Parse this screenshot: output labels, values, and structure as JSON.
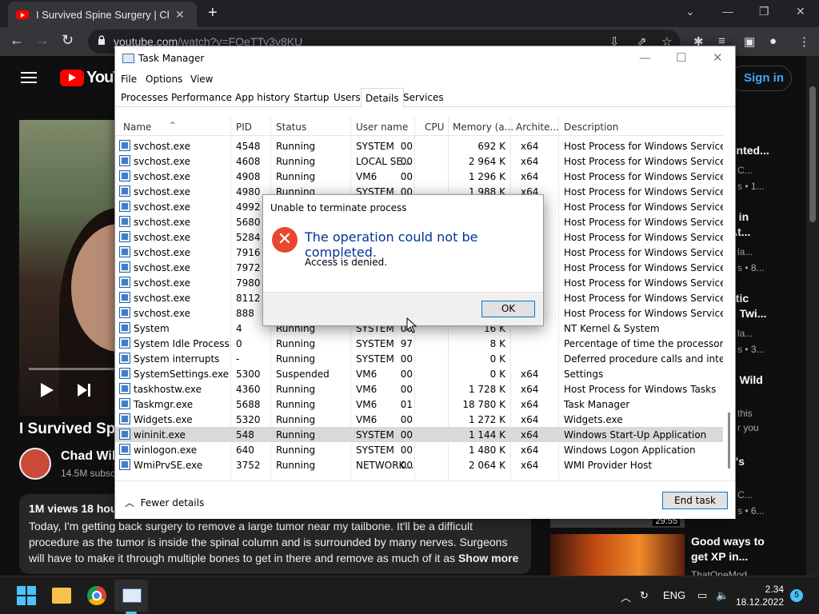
{
  "browser": {
    "tab_title": "I Survived Spine Surgery | Chad W",
    "url_host": "youtube.com",
    "url_path": "/watch?v=FOeTTy3v8KU"
  },
  "youtube": {
    "logo_text": "YouTu",
    "signin": "Sign in",
    "video_title": "I Survived Spi",
    "channel_name": "Chad Wil",
    "channel_subs": "14.5M subsc",
    "desc_stats": "1M views  18 hou",
    "desc_text": "Today, I'm getting back surgery to remove a large tumor near my tailbone. It'll be a difficult procedure as the tumor is inside the spinal column and is surrounded by many nerves. Surgeons will have to make it through multiple bones to get in there and remove as much of it as",
    "show_more": "Show more",
    "recs": [
      {
        "line1": "e",
        "line2": "unted...",
        "meta1": "C...",
        "meta2": "s • 1..."
      },
      {
        "line1": "e in",
        "line2": "At...",
        "meta1": "la...",
        "meta2": "s • 8..."
      },
      {
        "line1": "stic",
        "line2": "o Twi...",
        "meta1": "la...",
        "meta2": "s • 3..."
      },
      {
        "line1": "d Wild",
        "line2": "",
        "meta1": "this",
        "meta2": "r you"
      },
      {
        "line1": "e's",
        "line2": "",
        "meta1": "C...",
        "meta2": "s • 6..."
      },
      {
        "line1": "Good ways to",
        "line2": "get XP in...",
        "meta1": "ThatOneMod",
        "meta2": ""
      }
    ],
    "thumb_time": "29:55"
  },
  "taskmgr": {
    "title": "Task Manager",
    "menu": [
      "File",
      "Options",
      "View"
    ],
    "tabs": [
      "Processes",
      "Performance",
      "App history",
      "Startup",
      "Users",
      "Details",
      "Services"
    ],
    "columns": [
      "Name",
      "PID",
      "Status",
      "User name",
      "CPU",
      "Memory (a...",
      "Archite...",
      "Description"
    ],
    "rows": [
      [
        "svchost.exe",
        "4548",
        "Running",
        "SYSTEM",
        "00",
        "692 K",
        "x64",
        "Host Process for Windows Services"
      ],
      [
        "svchost.exe",
        "4608",
        "Running",
        "LOCAL SE...",
        "00",
        "2 964 K",
        "x64",
        "Host Process for Windows Services"
      ],
      [
        "svchost.exe",
        "4908",
        "Running",
        "VM6",
        "00",
        "1 296 K",
        "x64",
        "Host Process for Windows Services"
      ],
      [
        "svchost.exe",
        "4980",
        "Running",
        "SYSTEM",
        "00",
        "1 988 K",
        "x64",
        "Host Process for Windows Services"
      ],
      [
        "svchost.exe",
        "4992",
        "",
        "",
        "",
        "",
        "",
        "Host Process for Windows Services"
      ],
      [
        "svchost.exe",
        "5680",
        "",
        "",
        "",
        "",
        "",
        "Host Process for Windows Services"
      ],
      [
        "svchost.exe",
        "5284",
        "",
        "",
        "",
        "",
        "",
        "Host Process for Windows Services"
      ],
      [
        "svchost.exe",
        "7916",
        "",
        "",
        "",
        "",
        "",
        "Host Process for Windows Services"
      ],
      [
        "svchost.exe",
        "7972",
        "",
        "",
        "",
        "",
        "",
        "Host Process for Windows Services"
      ],
      [
        "svchost.exe",
        "7980",
        "",
        "",
        "",
        "",
        "",
        "Host Process for Windows Services"
      ],
      [
        "svchost.exe",
        "8112",
        "",
        "",
        "",
        "",
        "",
        "Host Process for Windows Services"
      ],
      [
        "svchost.exe",
        "888",
        "",
        "",
        "",
        "",
        "",
        "Host Process for Windows Services"
      ],
      [
        "System",
        "4",
        "Running",
        "SYSTEM",
        "00",
        "16 K",
        "",
        "NT Kernel & System"
      ],
      [
        "System Idle Process",
        "0",
        "Running",
        "SYSTEM",
        "97",
        "8 K",
        "",
        "Percentage of time the processor i..."
      ],
      [
        "System interrupts",
        "-",
        "Running",
        "SYSTEM",
        "00",
        "0 K",
        "",
        "Deferred procedure calls and inter..."
      ],
      [
        "SystemSettings.exe",
        "5300",
        "Suspended",
        "VM6",
        "00",
        "0 K",
        "x64",
        "Settings"
      ],
      [
        "taskhostw.exe",
        "4360",
        "Running",
        "VM6",
        "00",
        "1 728 K",
        "x64",
        "Host Process for Windows Tasks"
      ],
      [
        "Taskmgr.exe",
        "5688",
        "Running",
        "VM6",
        "01",
        "18 780 K",
        "x64",
        "Task Manager"
      ],
      [
        "Widgets.exe",
        "5320",
        "Running",
        "VM6",
        "00",
        "1 272 K",
        "x64",
        "Widgets.exe"
      ],
      [
        "wininit.exe",
        "548",
        "Running",
        "SYSTEM",
        "00",
        "1 144 K",
        "x64",
        "Windows Start-Up Application"
      ],
      [
        "winlogon.exe",
        "640",
        "Running",
        "SYSTEM",
        "00",
        "1 480 K",
        "x64",
        "Windows Logon Application"
      ],
      [
        "WmiPrvSE.exe",
        "3752",
        "Running",
        "NETWORK...",
        "00",
        "2 064 K",
        "x64",
        "WMI Provider Host"
      ]
    ],
    "selected_row": 19,
    "fewer_details": "Fewer details",
    "end_task": "End task"
  },
  "dialog": {
    "title": "Unable to terminate process",
    "main": "The operation could not be completed.",
    "sub": "Access is denied.",
    "ok": "OK"
  },
  "taskbar": {
    "lang": "ENG",
    "time": "2.34",
    "date": "18.12.2022",
    "notifications": "5"
  },
  "colors": {
    "youtube_red": "#ff0000",
    "link_blue": "#3ea6ff",
    "dialog_heading": "#003399",
    "error_icon": "#e8492c",
    "accent": "#0078d4"
  }
}
